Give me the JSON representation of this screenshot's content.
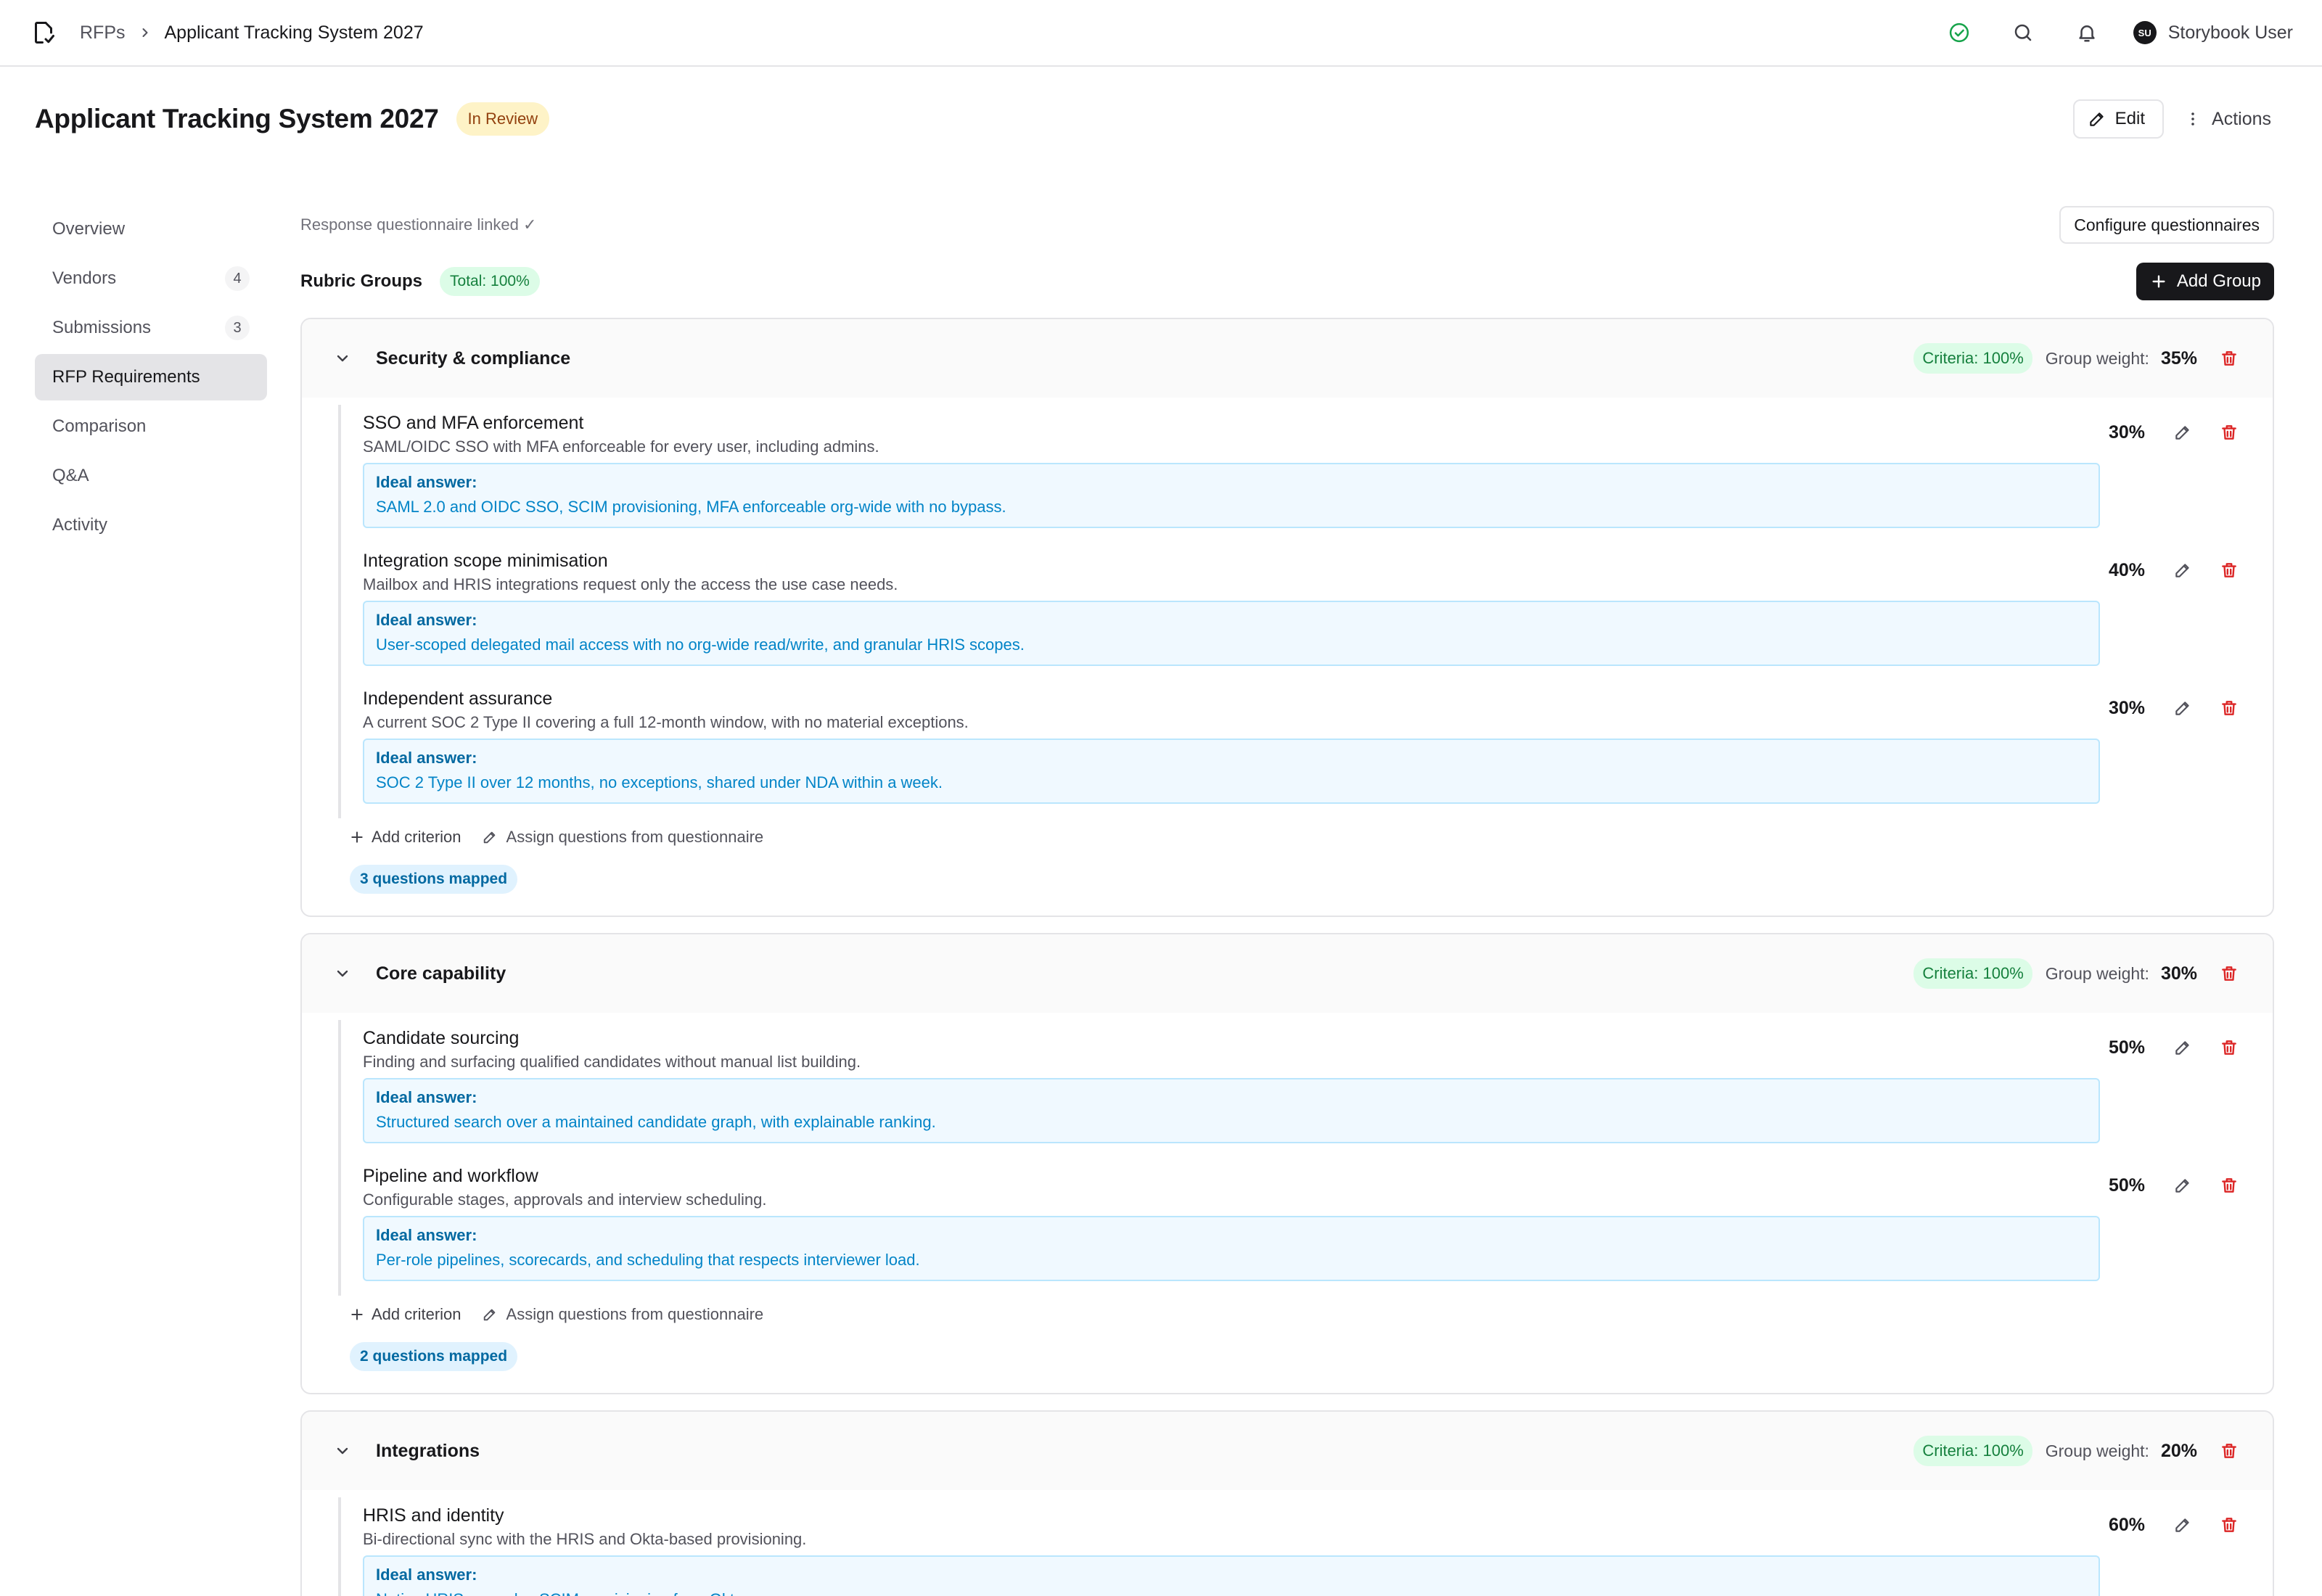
{
  "topbar": {
    "logo_icon": "document-check-icon",
    "breadcrumb_root": "RFPs",
    "breadcrumb_current": "Applicant Tracking System 2027",
    "user_initials": "SU",
    "user_name": "Storybook User"
  },
  "header": {
    "title": "Applicant Tracking System 2027",
    "status": "In Review",
    "edit_label": "Edit",
    "actions_label": "Actions"
  },
  "sidebar": {
    "items": [
      {
        "label": "Overview",
        "count": ""
      },
      {
        "label": "Vendors",
        "count": "4"
      },
      {
        "label": "Submissions",
        "count": "3"
      },
      {
        "label": "RFP Requirements",
        "count": ""
      },
      {
        "label": "Comparison",
        "count": ""
      },
      {
        "label": "Q&A",
        "count": ""
      },
      {
        "label": "Activity",
        "count": ""
      }
    ],
    "active": "RFP Requirements"
  },
  "main": {
    "linked_text": "Response questionnaire linked ✓",
    "configure_label": "Configure questionnaires",
    "rubric_title": "Rubric Groups",
    "total_label": "Total: 100%",
    "add_group_label": "Add Group",
    "weight_label": "Group weight:",
    "ideal_label": "Ideal answer:",
    "add_criterion_label": "Add criterion",
    "assign_label": "Assign questions from questionnaire",
    "groups": [
      {
        "name": "Security & compliance",
        "criteria_label": "Criteria: 100%",
        "weight": "35%",
        "mapped": "3 questions mapped",
        "criteria": [
          {
            "title": "SSO and MFA enforcement",
            "desc": "SAML/OIDC SSO with MFA enforceable for every user, including admins.",
            "ideal": "SAML 2.0 and OIDC SSO, SCIM provisioning, MFA enforceable org-wide with no bypass.",
            "pct": "30%"
          },
          {
            "title": "Integration scope minimisation",
            "desc": "Mailbox and HRIS integrations request only the access the use case needs.",
            "ideal": "User-scoped delegated mail access with no org-wide read/write, and granular HRIS scopes.",
            "pct": "40%"
          },
          {
            "title": "Independent assurance",
            "desc": "A current SOC 2 Type II covering a full 12-month window, with no material exceptions.",
            "ideal": "SOC 2 Type II over 12 months, no exceptions, shared under NDA within a week.",
            "pct": "30%"
          }
        ]
      },
      {
        "name": "Core capability",
        "criteria_label": "Criteria: 100%",
        "weight": "30%",
        "mapped": "2 questions mapped",
        "criteria": [
          {
            "title": "Candidate sourcing",
            "desc": "Finding and surfacing qualified candidates without manual list building.",
            "ideal": "Structured search over a maintained candidate graph, with explainable ranking.",
            "pct": "50%"
          },
          {
            "title": "Pipeline and workflow",
            "desc": "Configurable stages, approvals and interview scheduling.",
            "ideal": "Per-role pipelines, scorecards, and scheduling that respects interviewer load.",
            "pct": "50%"
          }
        ]
      },
      {
        "name": "Integrations",
        "criteria_label": "Criteria: 100%",
        "weight": "20%",
        "criteria": [
          {
            "title": "HRIS and identity",
            "desc": "Bi-directional sync with the HRIS and Okta-based provisioning.",
            "ideal": "Native HRIS sync plus SCIM provisioning from Okta.",
            "pct": "60%"
          }
        ]
      }
    ]
  },
  "colors": {
    "danger": "#dc2626",
    "success": "#16a34a",
    "ideal_blue": "#0284c7",
    "status_amber": "#92400e"
  }
}
